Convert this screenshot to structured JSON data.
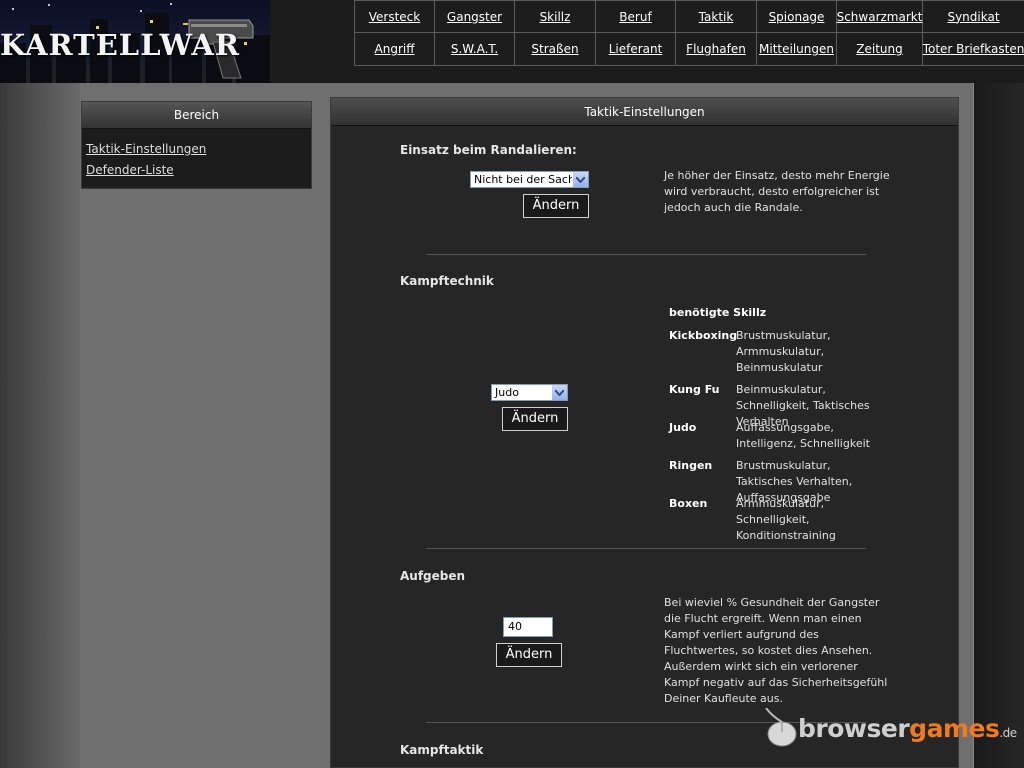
{
  "logo": {
    "text": "KARTELLWAR"
  },
  "nav": {
    "items": [
      "Versteck",
      "Gangster",
      "Skillz",
      "Beruf",
      "Taktik",
      "Spionage",
      "Schwarzmarkt",
      "Syndikat",
      "Angriff",
      "S.W.A.T.",
      "Straßen",
      "Lieferant",
      "Flughafen",
      "Mitteilungen",
      "Zeitung",
      "Toter Briefkasten"
    ]
  },
  "sidebar": {
    "title": "Bereich",
    "items": [
      "Taktik-Einstellungen",
      "Defender-Liste"
    ]
  },
  "main": {
    "title": "Taktik-Einstellungen",
    "randalieren": {
      "heading": "Einsatz beim Randalieren:",
      "select_value": "Nicht bei der Sache",
      "button": "Ändern",
      "description": "Je höher der Einsatz, desto mehr Energie wird verbraucht, desto erfolgreicher ist jedoch auch die Randale."
    },
    "kampftechnik": {
      "heading": "Kampftechnik",
      "select_value": "Judo",
      "button": "Ändern",
      "skills_heading": "benötigte Skillz",
      "skills": [
        {
          "name": "Kickboxing",
          "req": "Brustmuskulatur, Armmuskulatur, Beinmuskulatur"
        },
        {
          "name": "Kung Fu",
          "req": "Beinmuskulatur, Schnelligkeit, Taktisches Verhalten"
        },
        {
          "name": "Judo",
          "req": "Auffassungsgabe, Intelligenz, Schnelligkeit"
        },
        {
          "name": "Ringen",
          "req": "Brustmuskulatur, Taktisches Verhalten, Auffassungsgabe"
        },
        {
          "name": "Boxen",
          "req": "Armmuskulatur, Schnelligkeit, Konditionstraining"
        }
      ]
    },
    "aufgeben": {
      "heading": "Aufgeben",
      "input_value": "40",
      "button": "Ändern",
      "description": "Bei wieviel % Gesundheit der Gangster die Flucht ergreift. Wenn man einen Kampf verliert aufgrund des Fluchtwertes, so kostet dies Ansehen. Außerdem wirkt sich ein verlorener Kampf negativ auf das Sicherheitsgefühl Deiner Kaufleute aus."
    },
    "kampftaktik": {
      "heading": "Kampftaktik"
    }
  },
  "watermark": {
    "part1": "browser",
    "part2": "games",
    "suffix": ".de"
  }
}
